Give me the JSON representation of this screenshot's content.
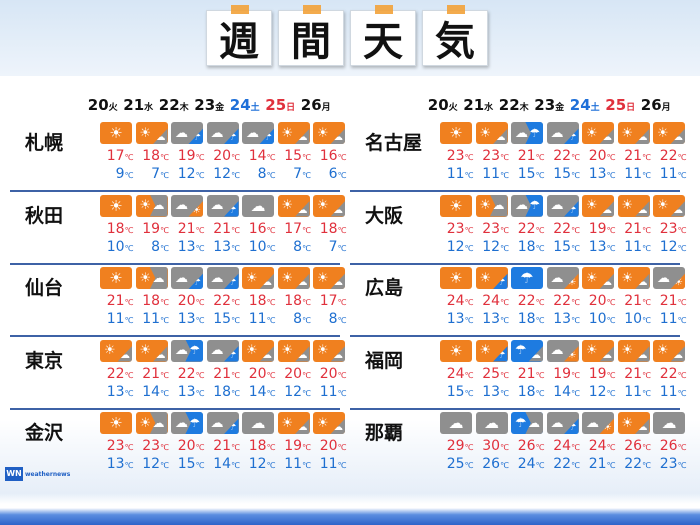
{
  "title": [
    "週",
    "間",
    "天",
    "気"
  ],
  "dates": [
    {
      "day": "20",
      "wd": "火",
      "type": "weekday"
    },
    {
      "day": "21",
      "wd": "水",
      "type": "weekday"
    },
    {
      "day": "22",
      "wd": "木",
      "type": "weekday"
    },
    {
      "day": "23",
      "wd": "金",
      "type": "weekday"
    },
    {
      "day": "24",
      "wd": "土",
      "type": "sat"
    },
    {
      "day": "25",
      "wd": "日",
      "type": "sun"
    },
    {
      "day": "26",
      "wd": "月",
      "type": "weekday"
    }
  ],
  "unit": "℃",
  "colors": {
    "sun": "#f0801f",
    "cloud": "#8f8f8f",
    "rain": "#1e7be0",
    "high": "#e0303c",
    "low": "#1e6fd0"
  },
  "left_cities": [
    {
      "name": "札幌",
      "icons": [
        "sun",
        "sun/cloud",
        "cloud/rain",
        "cloud/rain",
        "cloud/rain",
        "sun/cloud",
        "sun/cloud"
      ],
      "high": [
        17,
        18,
        19,
        20,
        14,
        15,
        16
      ],
      "low": [
        9,
        7,
        12,
        12,
        8,
        7,
        6
      ]
    },
    {
      "name": "秋田",
      "icons": [
        "sun",
        "sun>cloud",
        "cloud/sun",
        "cloud/rain",
        "cloud",
        "sun/cloud",
        "sun/cloud"
      ],
      "high": [
        18,
        19,
        21,
        21,
        16,
        17,
        18
      ],
      "low": [
        10,
        8,
        13,
        13,
        10,
        8,
        7
      ]
    },
    {
      "name": "仙台",
      "icons": [
        "sun",
        "sun>cloud",
        "cloud/rain",
        "cloud/rain",
        "sun/cloud",
        "sun/cloud",
        "sun/cloud"
      ],
      "high": [
        21,
        18,
        20,
        22,
        18,
        18,
        17
      ],
      "low": [
        11,
        11,
        13,
        15,
        11,
        8,
        8
      ]
    },
    {
      "name": "東京",
      "icons": [
        "sun/cloud",
        "sun/cloud",
        "cloud>rain",
        "cloud/rain",
        "sun/cloud",
        "sun/cloud",
        "sun/cloud"
      ],
      "high": [
        22,
        21,
        22,
        21,
        20,
        20,
        20
      ],
      "low": [
        13,
        14,
        13,
        18,
        14,
        12,
        11
      ]
    },
    {
      "name": "金沢",
      "icons": [
        "sun",
        "sun>cloud",
        "cloud>rain",
        "cloud/rain",
        "cloud",
        "sun/cloud",
        "sun/cloud"
      ],
      "high": [
        23,
        23,
        20,
        21,
        18,
        19,
        20
      ],
      "low": [
        13,
        12,
        15,
        14,
        12,
        11,
        11
      ]
    }
  ],
  "right_cities": [
    {
      "name": "名古屋",
      "icons": [
        "sun",
        "sun/cloud",
        "cloud>rain",
        "cloud/rain",
        "sun/cloud",
        "sun/cloud",
        "sun/cloud"
      ],
      "high": [
        23,
        23,
        21,
        22,
        20,
        21,
        22
      ],
      "low": [
        11,
        11,
        15,
        15,
        13,
        11,
        11
      ]
    },
    {
      "name": "大阪",
      "icons": [
        "sun",
        "sun>cloud",
        "cloud>rain",
        "cloud/rain",
        "sun/cloud",
        "sun/cloud",
        "sun/cloud"
      ],
      "high": [
        23,
        23,
        22,
        22,
        19,
        21,
        23
      ],
      "low": [
        12,
        12,
        18,
        15,
        13,
        11,
        12
      ]
    },
    {
      "name": "広島",
      "icons": [
        "sun",
        "sun/rain",
        "rain",
        "cloud/sun",
        "sun/cloud",
        "sun/cloud",
        "cloud/sun"
      ],
      "high": [
        24,
        24,
        22,
        22,
        20,
        21,
        21
      ],
      "low": [
        13,
        13,
        18,
        13,
        10,
        10,
        11
      ]
    },
    {
      "name": "福岡",
      "icons": [
        "sun",
        "sun/rain",
        "rain/cloud",
        "cloud/sun",
        "sun/cloud",
        "sun/cloud",
        "sun/cloud"
      ],
      "high": [
        24,
        25,
        21,
        19,
        19,
        21,
        22
      ],
      "low": [
        15,
        13,
        18,
        14,
        12,
        11,
        11
      ]
    },
    {
      "name": "那覇",
      "icons": [
        "cloud",
        "cloud",
        "rain>cloud",
        "cloud/rain",
        "cloud/sun",
        "sun/cloud",
        "cloud"
      ],
      "high": [
        29,
        30,
        26,
        24,
        24,
        26,
        26
      ],
      "low": [
        25,
        26,
        24,
        22,
        21,
        22,
        23
      ]
    }
  ],
  "logo": {
    "mark": "WN",
    "text": "weathernews"
  }
}
